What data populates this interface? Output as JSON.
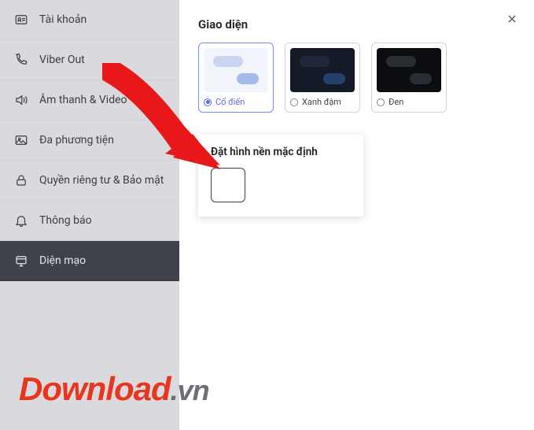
{
  "sidebar": {
    "items": [
      {
        "label": "Tài khoản"
      },
      {
        "label": "Viber Out"
      },
      {
        "label": "Âm thanh & Video"
      },
      {
        "label": "Đa phương tiện"
      },
      {
        "label": "Quyền riêng tư & Bảo mật"
      },
      {
        "label": "Thông báo"
      },
      {
        "label": "Diện mạo"
      }
    ]
  },
  "content": {
    "section_title": "Giao diện",
    "themes": [
      {
        "label": "Cổ điển"
      },
      {
        "label": "Xanh đậm"
      },
      {
        "label": "Đen"
      }
    ],
    "bg_section_title": "Đặt hình nền mặc định"
  },
  "watermark": {
    "main": "Download",
    "suffix": ".vn"
  }
}
